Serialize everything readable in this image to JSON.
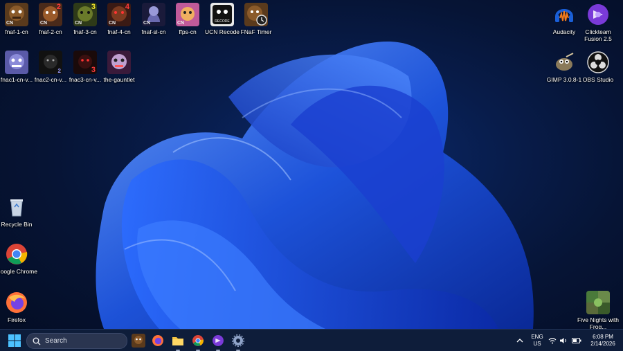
{
  "desktop_icons_top_row": [
    {
      "label": "fnaf-1-cn",
      "badge": "CN",
      "num": ""
    },
    {
      "label": "fnaf-2-cn",
      "badge": "CN",
      "num": "2"
    },
    {
      "label": "fnaf-3-cn",
      "badge": "CN",
      "num": "3"
    },
    {
      "label": "fnaf-4-cn",
      "badge": "CN",
      "num": "4"
    },
    {
      "label": "fnaf-sl-cn",
      "badge": "CN",
      "num": ""
    },
    {
      "label": "ffps-cn",
      "badge": "CN",
      "num": ""
    },
    {
      "label": "UCN Recode",
      "badge": "",
      "num": ""
    },
    {
      "label": "FNaF Timer",
      "badge": "",
      "num": ""
    }
  ],
  "desktop_icons_second_row": [
    {
      "label": "fnac1-cn-v...",
      "num": ""
    },
    {
      "label": "fnac2-cn-v...",
      "num": "2"
    },
    {
      "label": "fnac3-cn-v...",
      "num": "3"
    },
    {
      "label": "the-gauntlet",
      "num": ""
    }
  ],
  "desktop_icons_right": [
    {
      "label": "Audacity"
    },
    {
      "label": "Clickteam Fusion 2.5"
    },
    {
      "label": "GIMP 3.0.8-1"
    },
    {
      "label": "OBS Studio"
    },
    {
      "label": "Five Nights with Frog..."
    }
  ],
  "desktop_icons_left": [
    {
      "label": "Recycle Bin"
    },
    {
      "label": "Google Chrome"
    },
    {
      "label": "Firefox"
    }
  ],
  "ucn_recode_text": "RECODE",
  "taskbar": {
    "search_placeholder": "Search",
    "lang": "ENG",
    "region": "US",
    "time": "6:08 PM",
    "date": "2/14/2026"
  }
}
